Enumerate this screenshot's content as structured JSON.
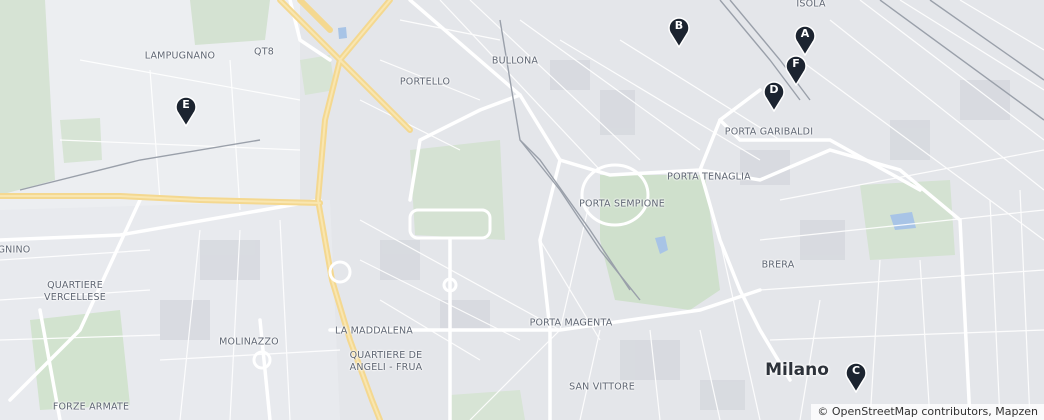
{
  "map": {
    "city_label": "Milano",
    "district_labels": [
      {
        "id": "isola",
        "text": "ISOLA"
      },
      {
        "id": "lampugnano",
        "text": "LAMPUGNANO"
      },
      {
        "id": "qt8",
        "text": "QT8"
      },
      {
        "id": "bullona",
        "text": "BULLONA"
      },
      {
        "id": "portello",
        "text": "PORTELLO"
      },
      {
        "id": "porta-garibaldi",
        "text": "PORTA GARIBALDI"
      },
      {
        "id": "porta-tenaglia",
        "text": "PORTA TENAGLIA"
      },
      {
        "id": "porta-sempione",
        "text": "PORTA SEMPIONE"
      },
      {
        "id": "brera",
        "text": "BRERA"
      },
      {
        "id": "gnino",
        "text": "GNINO"
      },
      {
        "id": "quartiere-vercellese",
        "text": "QUARTIERE\nVERCELLESE"
      },
      {
        "id": "la-maddalena",
        "text": "LA MADDALENA"
      },
      {
        "id": "molinazzo",
        "text": "MOLINAZZO"
      },
      {
        "id": "quartiere-angeli-frua",
        "text": "QUARTIERE DE\nANGELI - FRUA"
      },
      {
        "id": "porta-magenta",
        "text": "PORTA MAGENTA"
      },
      {
        "id": "san-vittore",
        "text": "SAN VITTORE"
      },
      {
        "id": "forze-armate",
        "text": "FORZE ARMATE"
      }
    ],
    "markers": [
      {
        "id": "A",
        "label": "A"
      },
      {
        "id": "B",
        "label": "B"
      },
      {
        "id": "C",
        "label": "C"
      },
      {
        "id": "D",
        "label": "D"
      },
      {
        "id": "E",
        "label": "E"
      },
      {
        "id": "F",
        "label": "F"
      }
    ],
    "marker_color": "#1c2430",
    "attribution": {
      "symbol": "©",
      "osm_link": "OpenStreetMap contributors",
      "separator": ",",
      "mapzen_link": "Mapzen"
    }
  }
}
